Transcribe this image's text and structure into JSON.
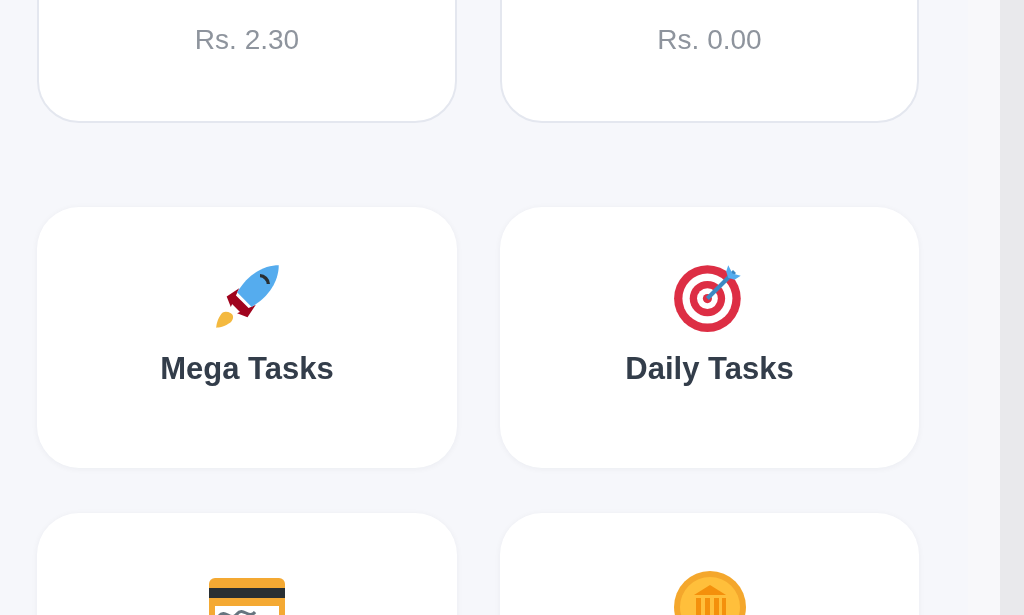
{
  "balance_cards": [
    {
      "amount": "Rs. 2.30"
    },
    {
      "amount": "Rs. 0.00"
    }
  ],
  "task_cards": [
    {
      "kind": "rocket",
      "label": "Mega Tasks"
    },
    {
      "kind": "target",
      "label": "Daily Tasks"
    },
    {
      "kind": "card"
    },
    {
      "kind": "bank"
    }
  ]
}
